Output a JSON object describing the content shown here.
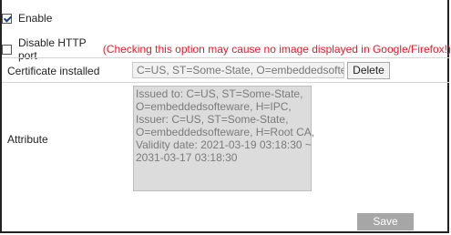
{
  "enable": {
    "label": "Enable",
    "checked": true
  },
  "disable_http": {
    "label": "Disable HTTP port",
    "checked": false,
    "warning": "(Checking this option may cause no image displayed in Google/Firefox!)"
  },
  "certificate": {
    "label": "Certificate installed",
    "value": "C=US, ST=Some-State, O=embeddedsoftew",
    "delete_label": "Delete"
  },
  "attribute": {
    "label": "Attribute",
    "lines": [
      "Issued to: C=US, ST=Some-State,",
      "O=embeddedsofteware, H=IPC,",
      "Issuer: C=US, ST=Some-State,",
      "O=embeddedsofteware, H=Root CA,",
      "Validity date: 2021-03-19 03:18:30 ~",
      "2031-03-17 03:18:30"
    ]
  },
  "save_label": "Save"
}
